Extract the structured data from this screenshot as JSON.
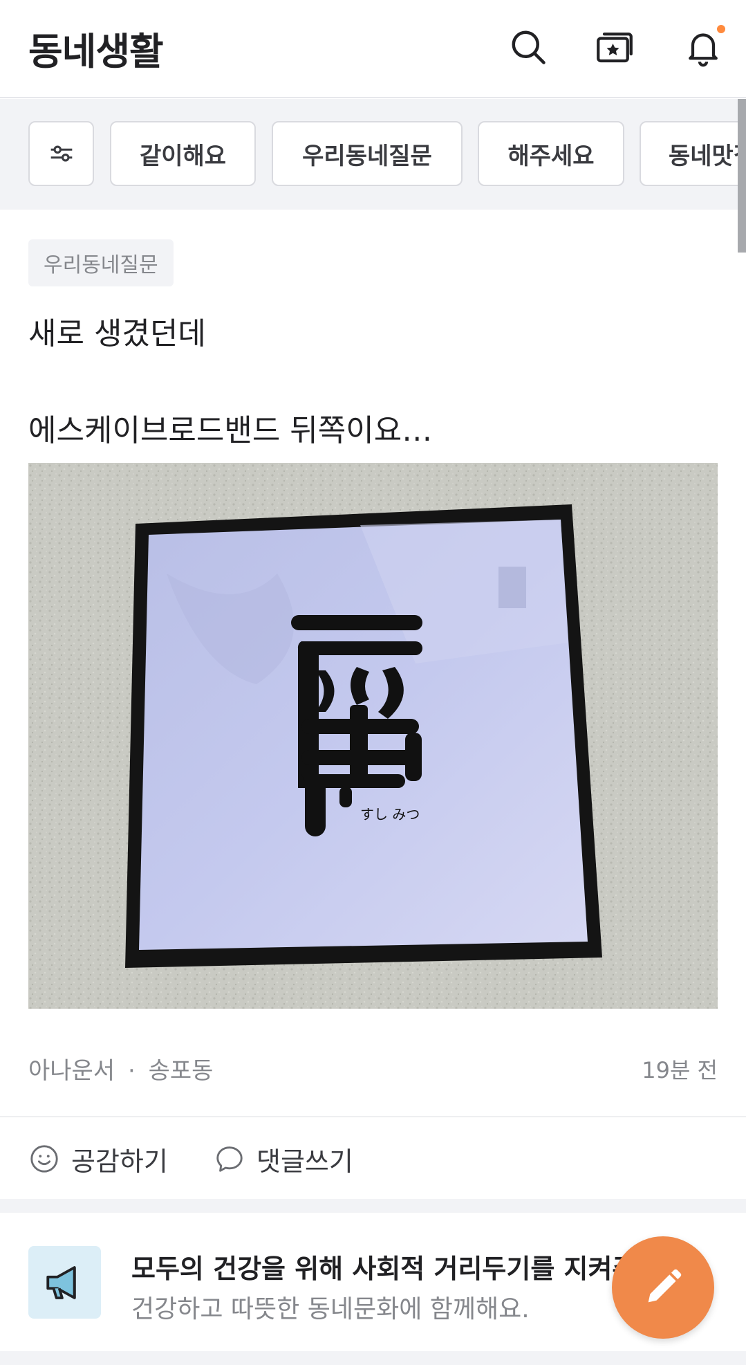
{
  "header": {
    "title": "동네생활",
    "icons": [
      "search-icon",
      "bookmark-star-icon",
      "bell-icon"
    ],
    "has_notification_dot": true
  },
  "chips": {
    "filter_icon": "sliders-icon",
    "items": [
      {
        "label": "같이해요"
      },
      {
        "label": "우리동네질문"
      },
      {
        "label": "해주세요"
      },
      {
        "label": "동네맛집"
      }
    ]
  },
  "post": {
    "category": "우리동네질문",
    "text_line1": "새로 생겼던데",
    "text_line2": "에스케이브로드밴드 뒤쪽이요…",
    "image_alt": "sushi sign",
    "image_caption": "すし みつ",
    "author": "아나운서",
    "separator": "·",
    "location": "송포동",
    "time": "19분 전",
    "actions": {
      "like": "공감하기",
      "comment": "댓글쓰기"
    }
  },
  "notice": {
    "icon": "megaphone-icon",
    "title": "모두의 건강을 위해 사회적 거리두기를 지켜주세요",
    "subtitle": "건강하고 따뜻한 동네문화에 함께해요."
  },
  "fab": {
    "icon": "pencil-icon"
  },
  "colors": {
    "accent": "#f0894a",
    "notification_dot": "#ff8a3d",
    "chip_bar_bg": "#f2f3f6",
    "text_primary": "#212124",
    "text_secondary": "#85878c"
  }
}
